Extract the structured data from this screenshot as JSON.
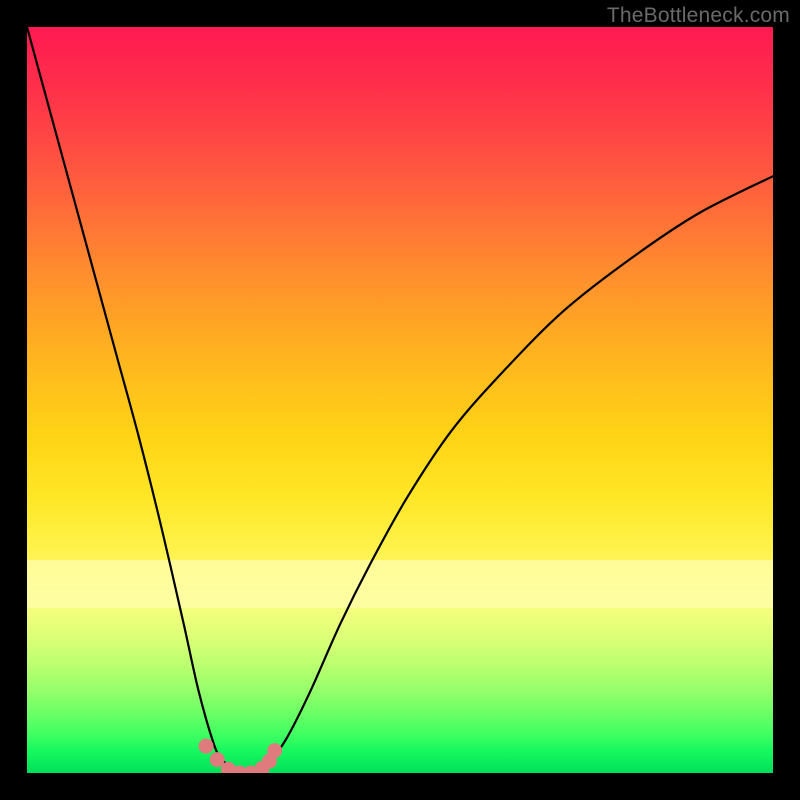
{
  "watermark": "TheBottleneck.com",
  "chart_data": {
    "type": "line",
    "title": "",
    "xlabel": "",
    "ylabel": "",
    "xlim": [
      0,
      100
    ],
    "ylim": [
      0,
      100
    ],
    "grid": false,
    "legend": false,
    "background_gradient": {
      "stops": [
        {
          "pos": 0.0,
          "color": "#ff1a52"
        },
        {
          "pos": 0.32,
          "color": "#ff8a2f"
        },
        {
          "pos": 0.63,
          "color": "#ffe726"
        },
        {
          "pos": 0.77,
          "color": "#f9fd7f"
        },
        {
          "pos": 1.0,
          "color": "#00e05a"
        }
      ]
    },
    "series": [
      {
        "name": "bottleneck-curve",
        "x": [
          0,
          3,
          6,
          9,
          12,
          15,
          18,
          21,
          23,
          25,
          26,
          27,
          28,
          29,
          30,
          31,
          32,
          33,
          35,
          38,
          42,
          46,
          51,
          57,
          64,
          72,
          81,
          90,
          100
        ],
        "y": [
          100,
          89,
          78,
          67,
          56,
          45,
          33,
          20,
          11,
          4,
          2,
          1,
          0,
          0,
          0,
          0,
          1,
          2,
          5,
          11,
          20,
          28,
          37,
          46,
          54,
          62,
          69,
          75,
          80
        ]
      },
      {
        "name": "curve-bottom-dots",
        "type": "scatter",
        "color": "#e07b7d",
        "x": [
          24.0,
          25.5,
          27.0,
          28.5,
          30.0,
          31.5,
          32.5,
          33.2
        ],
        "y": [
          3.6,
          1.8,
          0.5,
          0.0,
          0.0,
          0.6,
          1.6,
          3.0
        ]
      }
    ]
  }
}
